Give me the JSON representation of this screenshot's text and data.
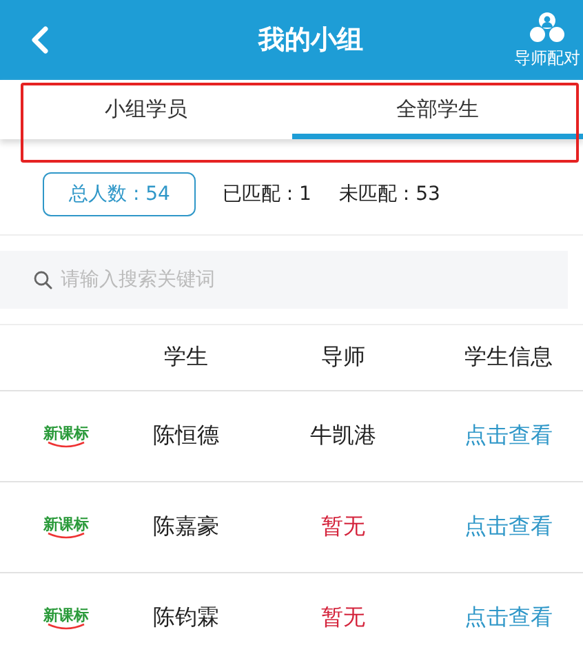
{
  "header": {
    "title": "我的小组",
    "action": "导师配对"
  },
  "tabs": [
    {
      "label": "小组学员",
      "selected": false
    },
    {
      "label": "全部学生",
      "selected": true
    }
  ],
  "stats": [
    {
      "label": "总人数 : 54",
      "selected": true
    },
    {
      "label": "已匹配 : 1",
      "selected": false
    },
    {
      "label": "未匹配 : 53",
      "selected": false
    }
  ],
  "search": {
    "placeholder": "请输入搜索关键词"
  },
  "table": {
    "columns": [
      "学生",
      "导师",
      "学生信息"
    ],
    "rows": [
      {
        "logo": "新课标",
        "student": "陈恒德",
        "tutor": "牛凯港",
        "matched": true,
        "info": "点击查看"
      },
      {
        "logo": "新课标",
        "student": "陈嘉豪",
        "tutor": "暂无",
        "matched": false,
        "info": "点击查看"
      },
      {
        "logo": "新课标",
        "student": "陈钧霖",
        "tutor": "暂无",
        "matched": false,
        "info": "点击查看"
      }
    ]
  }
}
